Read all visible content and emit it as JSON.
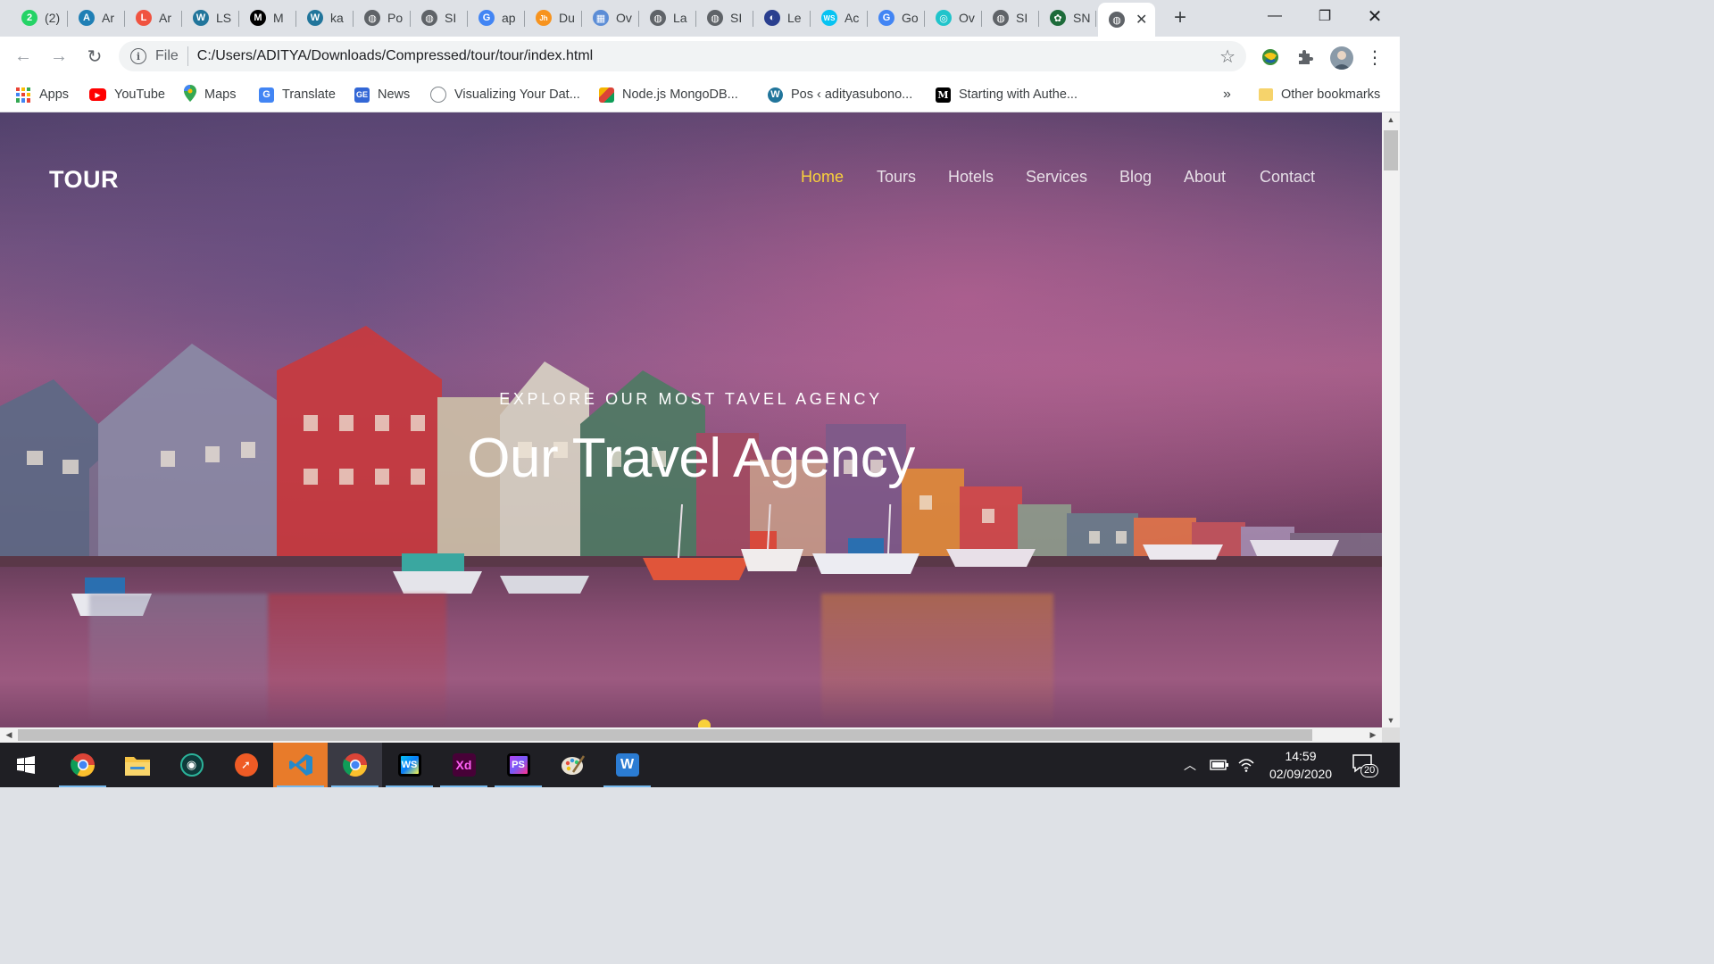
{
  "browser": {
    "tabs": [
      {
        "title": "(2)",
        "icon": "whatsapp-icon",
        "color": "#25d366",
        "glyph": "2"
      },
      {
        "title": "Ar",
        "icon": "parrot-icon",
        "color": "#1f7fb5",
        "glyph": "A"
      },
      {
        "title": "Ar",
        "icon": "laravel-icon",
        "color": "#f05340",
        "glyph": "L"
      },
      {
        "title": "LS",
        "icon": "wordpress-icon",
        "color": "#21759b",
        "glyph": "W"
      },
      {
        "title": "M",
        "icon": "medium-icon",
        "color": "#000000",
        "glyph": "M"
      },
      {
        "title": "ka",
        "icon": "wordpress-icon",
        "color": "#21759b",
        "glyph": "W"
      },
      {
        "title": "Po",
        "icon": "globe-icon",
        "color": "#5f6368",
        "glyph": "◍"
      },
      {
        "title": "SI",
        "icon": "globe-icon",
        "color": "#5f6368",
        "glyph": "◍"
      },
      {
        "title": "ap",
        "icon": "google-icon",
        "color": "#4285f4",
        "glyph": "G"
      },
      {
        "title": "Du",
        "icon": "jh-icon",
        "color": "#f7931e",
        "glyph": "Jh"
      },
      {
        "title": "Ov",
        "icon": "shapes-icon",
        "color": "#5c8dd6",
        "glyph": "▦"
      },
      {
        "title": "La",
        "icon": "globe-icon",
        "color": "#5f6368",
        "glyph": "◍"
      },
      {
        "title": "SI",
        "icon": "globe-icon",
        "color": "#5f6368",
        "glyph": "◍"
      },
      {
        "title": "Le",
        "icon": "logo-icon",
        "color": "#2a3f8f",
        "glyph": "◐"
      },
      {
        "title": "Ac",
        "icon": "webstorm-icon",
        "color": "#07c3f2",
        "glyph": "WS"
      },
      {
        "title": "Go",
        "icon": "translate-icon",
        "color": "#4285f4",
        "glyph": "G"
      },
      {
        "title": "Ov",
        "icon": "balloon-icon",
        "color": "#20c4cb",
        "glyph": "◎"
      },
      {
        "title": "SI",
        "icon": "globe-icon",
        "color": "#5f6368",
        "glyph": "◍"
      },
      {
        "title": "SN",
        "icon": "emblem-icon",
        "color": "#1d6b3a",
        "glyph": "✿"
      }
    ],
    "active_tab_icon": "globe-icon",
    "new_tab": "+",
    "address": {
      "scheme": "File",
      "url": "C:/Users/ADITYA/Downloads/Compressed/tour/tour/index.html"
    },
    "bookmarks": [
      {
        "label": "Apps",
        "icon": "apps-grid-icon"
      },
      {
        "label": "YouTube",
        "icon": "youtube-icon"
      },
      {
        "label": "Maps",
        "icon": "maps-pin-icon"
      },
      {
        "label": "Translate",
        "icon": "translate-icon"
      },
      {
        "label": "News",
        "icon": "news-icon"
      },
      {
        "label": "Visualizing Your Dat...",
        "icon": "globe-icon"
      },
      {
        "label": "Node.js MongoDB...",
        "icon": "colorful-icon"
      },
      {
        "label": "Pos ‹ adityasubono...",
        "icon": "wordpress-icon"
      },
      {
        "label": "Starting with Authe...",
        "icon": "medium-icon"
      }
    ],
    "more_bookmarks": "»",
    "other_bookmarks": "Other bookmarks"
  },
  "site": {
    "brand": "TOUR",
    "nav": [
      "Home",
      "Tours",
      "Hotels",
      "Services",
      "Blog",
      "About",
      "Contact"
    ],
    "active_nav": "Home",
    "eyebrow": "EXPLORE OUR MOST TAVEL AGENCY",
    "headline": "Our Travel Agency",
    "accent": "#f9d13b"
  },
  "taskbar": {
    "apps": [
      {
        "name": "Chrome",
        "icon": "chrome-icon"
      },
      {
        "name": "File Explorer",
        "icon": "folder-icon"
      },
      {
        "name": "GitKraken",
        "icon": "gitkraken-icon"
      },
      {
        "name": "Postman",
        "icon": "postman-icon"
      },
      {
        "name": "VS Code",
        "icon": "vscode-icon"
      },
      {
        "name": "Chrome (active)",
        "icon": "chrome-active-icon"
      },
      {
        "name": "WebStorm",
        "icon": "webstorm-icon",
        "label": "WS"
      },
      {
        "name": "Adobe XD",
        "icon": "adobe-xd-icon",
        "label": "Xd"
      },
      {
        "name": "PhpStorm",
        "icon": "phpstorm-icon",
        "label": "PS"
      },
      {
        "name": "Paint",
        "icon": "paint-palette-icon"
      },
      {
        "name": "Word",
        "icon": "word-icon",
        "label": "W"
      }
    ],
    "time": "14:59",
    "date": "02/09/2020",
    "notifications": "20"
  }
}
